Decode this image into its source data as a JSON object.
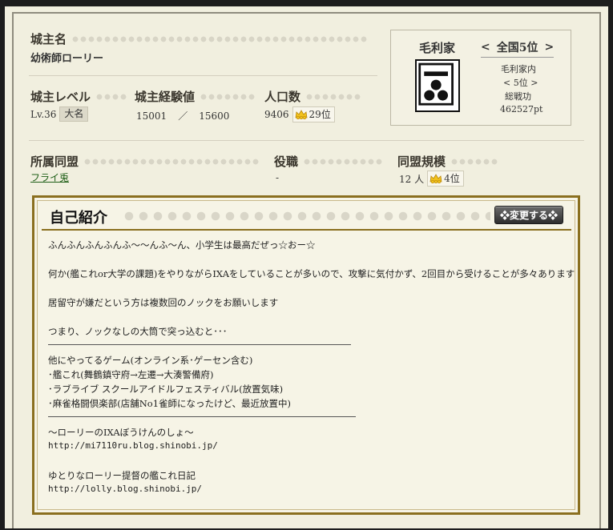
{
  "lord": {
    "name_label": "城主名",
    "name": "幼術師ローリー",
    "level_label": "城主レベル",
    "level": "Lv.36",
    "level_badge": "大名",
    "exp_label": "城主経験値",
    "exp_current": "15001",
    "exp_sep": "／",
    "exp_next": "15600",
    "pop_label": "人口数",
    "population": "9406",
    "pop_rank": "29位"
  },
  "family": {
    "name": "毛利家",
    "rank_prev": "<",
    "rank": "全国5位",
    "rank_next": ">",
    "inner_label": "毛利家内",
    "inner_rank": "< 5位 >",
    "merit_label": "総戦功",
    "merit": "462527pt"
  },
  "alliance": {
    "label": "所属同盟",
    "name": "フライ兎",
    "role_label": "役職",
    "role": "-",
    "size_label": "同盟規模",
    "size": "12 人",
    "size_rank": "4位"
  },
  "intro": {
    "title": "自己紹介",
    "change_button": "❖変更する❖",
    "lines": [
      "ふんふんふんふんふ～～んふ～ん、小学生は最高だぜっ☆おー☆",
      "何か(艦これor大学の課題)をやりながらIXAをしていることが多いので、攻撃に気付かず、2回目から受けることが多々あります",
      "居留守が嫌だという方は複数回のノックをお願いします",
      "つまり、ノックなしの大筒で突っ込むと･･･",
      "他にやってるゲーム(オンライン系･ゲーセン含む)",
      "･艦これ(舞鶴鎮守府→左遷→大湊警備府)",
      "･ラブライブ スクールアイドルフェスティバル(放置気味)",
      "･麻雀格闘倶楽部(店舗No1雀師になったけど、最近放置中)",
      "～ローリーのIXAぼうけんのしょ～",
      "http://mi7110ru.blog.shinobi.jp/",
      "ゆとりなローリー提督の艦これ日記",
      "http://lolly.blog.shinobi.jp/"
    ]
  },
  "icons": {
    "crown": "crown-icon",
    "crest": "mori-crest-icon",
    "title_ornament": "diamond-pattern"
  },
  "colors": {
    "background": "#f1efdf",
    "frame": "#1d1d1d",
    "gold_border": "#8a6f1f",
    "link": "#1f5f17"
  }
}
